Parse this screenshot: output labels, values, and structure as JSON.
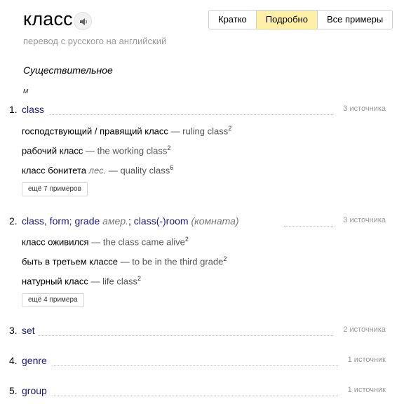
{
  "header": {
    "word": "класс",
    "subtitle": "перевод с русского на английский",
    "tabs": [
      "Кратко",
      "Подробно",
      "Все примеры"
    ]
  },
  "entry": {
    "part_of_speech": "Существительное",
    "gender": "м",
    "senses": [
      {
        "num": "1.",
        "word": "class",
        "sources": "3 источника",
        "examples": [
          {
            "ru": "господствующий / правящий класс",
            "en": "ruling class",
            "count": "2"
          },
          {
            "ru": "рабочий класс",
            "en": "the working class",
            "count": "2"
          },
          {
            "ru": "класс бонитета",
            "label": "лес.",
            "en": "quality class",
            "count": "6"
          }
        ],
        "more": "ещё 7 примеров"
      },
      {
        "num": "2.",
        "w1": "class, form; grade",
        "amer": "амер.",
        "semicolon": ";",
        "w2": "class(-)room",
        "room": "(комната)",
        "sources": "3 источника",
        "examples": [
          {
            "ru": "класс оживился",
            "en": "the class came alive",
            "count": "2"
          },
          {
            "ru": "быть в третьем классе",
            "en": "to be in the third grade",
            "count": "2"
          },
          {
            "ru": "натурный класс",
            "en": "life class",
            "count": "2"
          }
        ],
        "more": "ещё 4 примера"
      },
      {
        "num": "3.",
        "word": "set",
        "sources": "2 источника"
      },
      {
        "num": "4.",
        "word": "genre",
        "sources": "1 источник"
      },
      {
        "num": "5.",
        "word": "group",
        "sources": "1 источник"
      }
    ]
  },
  "dash": "—",
  "colors": {
    "active_tab": "#fff0a8",
    "link": "#1a1a80"
  }
}
